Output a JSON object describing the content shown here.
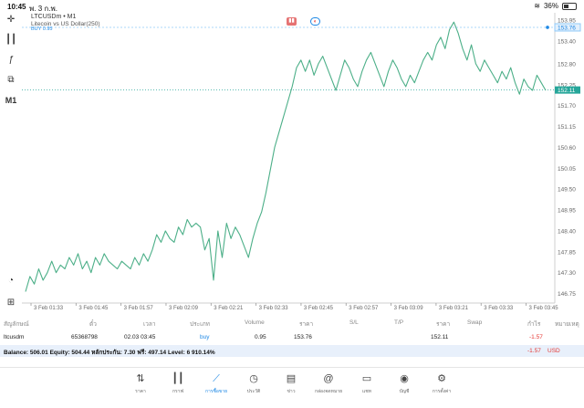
{
  "status_bar": {
    "time": "10:45",
    "date": "พ. 3 ก.พ.",
    "battery": "36%"
  },
  "chart_header": {
    "symbol": "LTCUSDm • M1",
    "description": "Litecoin vs US Dollar(250)",
    "order_label": "BUY 0.95"
  },
  "left_tools": {
    "timeframe": "M1"
  },
  "colors": {
    "line": "#4caf88",
    "accent": "#1e88e5",
    "loss": "#e53935",
    "current_price_tag": "#26a69a",
    "order_tag": "#90caf9"
  },
  "chart_data": {
    "type": "line",
    "title": "",
    "xlabel": "",
    "ylabel": "",
    "ylim": [
      146.5,
      154.0
    ],
    "grid": false,
    "y_ticks": [
      "153.95",
      "153.40",
      "152.80",
      "152.25",
      "151.70",
      "151.15",
      "150.60",
      "150.05",
      "149.50",
      "148.95",
      "148.40",
      "147.85",
      "147.30",
      "146.75"
    ],
    "x_ticks": [
      "3 Feb 01:33",
      "3 Feb 01:45",
      "3 Feb 01:57",
      "3 Feb 02:09",
      "3 Feb 02:21",
      "3 Feb 02:33",
      "3 Feb 02:45",
      "3 Feb 02:57",
      "3 Feb 03:09",
      "3 Feb 03:21",
      "3 Feb 03:33",
      "3 Feb 03:45"
    ],
    "current_price": "152.11",
    "order_price": "153.76",
    "series": [
      {
        "values": [
          146.8,
          147.2,
          147.0,
          147.4,
          147.1,
          147.3,
          147.6,
          147.3,
          147.5,
          147.4,
          147.7,
          147.5,
          147.8,
          147.4,
          147.6,
          147.3,
          147.7,
          147.5,
          147.8,
          147.6,
          147.5,
          147.4,
          147.6,
          147.5,
          147.4,
          147.7,
          147.5,
          147.8,
          147.6,
          147.9,
          148.3,
          148.1,
          148.4,
          148.2,
          148.1,
          148.5,
          148.3,
          148.7,
          148.5,
          148.6,
          148.5,
          147.9,
          148.2,
          147.1,
          148.4,
          147.7,
          148.6,
          148.2,
          148.5,
          148.3,
          148.0,
          147.7,
          148.2,
          148.6,
          148.9,
          149.4,
          150.0,
          150.6,
          151.0,
          151.4,
          151.8,
          152.2,
          152.7,
          152.9,
          152.6,
          152.9,
          152.5,
          152.8,
          153.0,
          152.7,
          152.4,
          152.1,
          152.5,
          152.9,
          152.7,
          152.4,
          152.2,
          152.6,
          152.9,
          153.1,
          152.8,
          152.5,
          152.2,
          152.6,
          152.9,
          152.7,
          152.4,
          152.2,
          152.5,
          152.3,
          152.6,
          152.9,
          153.1,
          152.9,
          153.3,
          153.5,
          153.2,
          153.7,
          153.9,
          153.6,
          153.2,
          152.9,
          153.3,
          152.8,
          152.6,
          152.9,
          152.7,
          152.5,
          152.3,
          152.6,
          152.4,
          152.7,
          152.3,
          152.0,
          152.4,
          152.2,
          152.1,
          152.5,
          152.3,
          152.1
        ]
      }
    ]
  },
  "positions_table": {
    "headers": [
      "สัญลักษณ์",
      "ตั๋ว",
      "เวลา",
      "ประเภท",
      "Volume",
      "ราคา",
      "S/L",
      "T/P",
      "ราคา",
      "Swap",
      "กำไร",
      "หมายเหตุ"
    ],
    "row": {
      "symbol": "ltcusdm",
      "ticket": "65368798",
      "time": "02.03 03:45",
      "type": "buy",
      "volume": "0.95",
      "open_price": "153.76",
      "price": "152.11",
      "profit": "-1.57"
    }
  },
  "balance_bar": {
    "text": "Balance: 506.01 Equity: 504.44 หลักประกัน: 7.30 ฟรี: 497.14 Level: 6 910.14%",
    "profit": "-1.57",
    "currency": "USD"
  },
  "tab_bar": {
    "tabs": [
      {
        "label": "ราคา",
        "icon": "quotes-icon"
      },
      {
        "label": "กราฟ",
        "icon": "chart-icon"
      },
      {
        "label": "การซื้อขาย",
        "icon": "trade-icon"
      },
      {
        "label": "ประวัติ",
        "icon": "history-icon"
      },
      {
        "label": "ข่าว",
        "icon": "news-icon"
      },
      {
        "label": "กล่องจดหมาย",
        "icon": "mailbox-icon"
      },
      {
        "label": "แชท",
        "icon": "chat-icon"
      },
      {
        "label": "บัญชี",
        "icon": "account-icon"
      },
      {
        "label": "การตั้งค่า",
        "icon": "settings-icon"
      }
    ],
    "active_index": 2
  }
}
